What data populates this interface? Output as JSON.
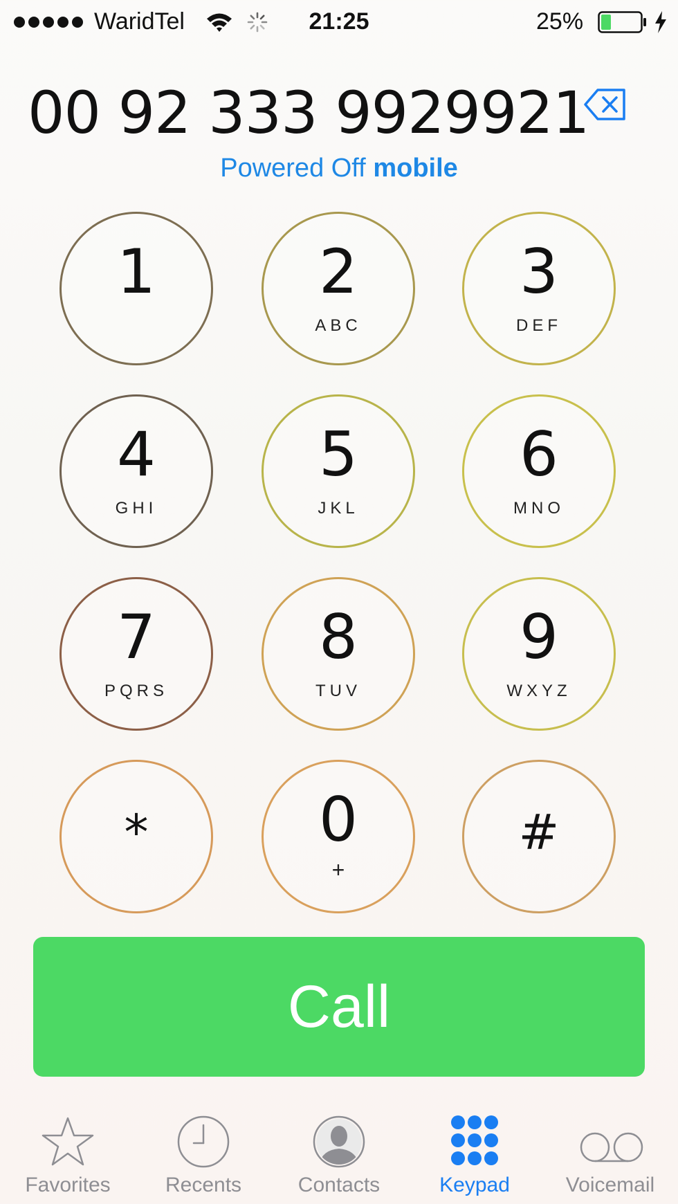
{
  "status_bar": {
    "carrier": "WaridTel",
    "time": "21:25",
    "battery_percent": "25%",
    "battery_level": 0.25,
    "signal_bars": 5,
    "icons": [
      "signal-icon",
      "wifi-icon",
      "activity-spinner-icon",
      "battery-icon",
      "charging-icon"
    ]
  },
  "dialer": {
    "number": "00 92 333 9929921",
    "caller_status": "Powered Off",
    "caller_type": "mobile",
    "delete_icon": "delete-backspace-icon"
  },
  "keypad": {
    "keys": [
      {
        "digit": "1",
        "letters": ""
      },
      {
        "digit": "2",
        "letters": "ABC"
      },
      {
        "digit": "3",
        "letters": "DEF"
      },
      {
        "digit": "4",
        "letters": "GHI"
      },
      {
        "digit": "5",
        "letters": "JKL"
      },
      {
        "digit": "6",
        "letters": "MNO"
      },
      {
        "digit": "7",
        "letters": "PQRS"
      },
      {
        "digit": "8",
        "letters": "TUV"
      },
      {
        "digit": "9",
        "letters": "WXYZ"
      },
      {
        "digit": "*",
        "letters": ""
      },
      {
        "digit": "0",
        "letters": "+"
      },
      {
        "digit": "#",
        "letters": ""
      }
    ]
  },
  "call_button": {
    "label": "Call"
  },
  "tab_bar": {
    "active": "Keypad",
    "tabs": [
      {
        "label": "Favorites",
        "icon": "star-icon"
      },
      {
        "label": "Recents",
        "icon": "clock-icon"
      },
      {
        "label": "Contacts",
        "icon": "contact-silhouette-icon"
      },
      {
        "label": "Keypad",
        "icon": "keypad-grid-icon"
      },
      {
        "label": "Voicemail",
        "icon": "voicemail-icon"
      }
    ]
  },
  "colors": {
    "accent": "#1a7ef2",
    "call_green": "#4cd964",
    "inactive_tab": "#8e8e93",
    "battery_fill": "#4cd964"
  }
}
